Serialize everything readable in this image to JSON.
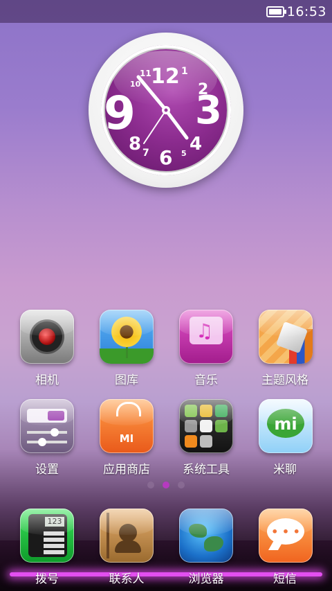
{
  "status_bar": {
    "time": "16:53",
    "battery_icon": "battery-full-icon"
  },
  "clock": {
    "numbers": [
      "12",
      "1",
      "2",
      "3",
      "4",
      "5",
      "6",
      "7",
      "8",
      "9",
      "10",
      "11"
    ],
    "hour_hand": "hour-hand",
    "minute_hand": "minute-hand"
  },
  "apps": [
    {
      "label": "相机",
      "icon": "camera-icon"
    },
    {
      "label": "图库",
      "icon": "gallery-icon"
    },
    {
      "label": "音乐",
      "icon": "music-icon"
    },
    {
      "label": "主题风格",
      "icon": "themes-icon"
    },
    {
      "label": "设置",
      "icon": "settings-icon"
    },
    {
      "label": "应用商店",
      "icon": "app-store-icon"
    },
    {
      "label": "系统工具",
      "icon": "system-tools-icon"
    },
    {
      "label": "米聊",
      "icon": "miliao-icon"
    }
  ],
  "dock": [
    {
      "label": "拨号",
      "icon": "phone-dialer-icon"
    },
    {
      "label": "联系人",
      "icon": "contacts-icon"
    },
    {
      "label": "浏览器",
      "icon": "browser-icon"
    },
    {
      "label": "短信",
      "icon": "sms-icon"
    }
  ],
  "page_indicator": {
    "pages": 3,
    "current": 2
  },
  "colors": {
    "accent": "#b63ac0",
    "dock_glow": "#e34ff0"
  }
}
